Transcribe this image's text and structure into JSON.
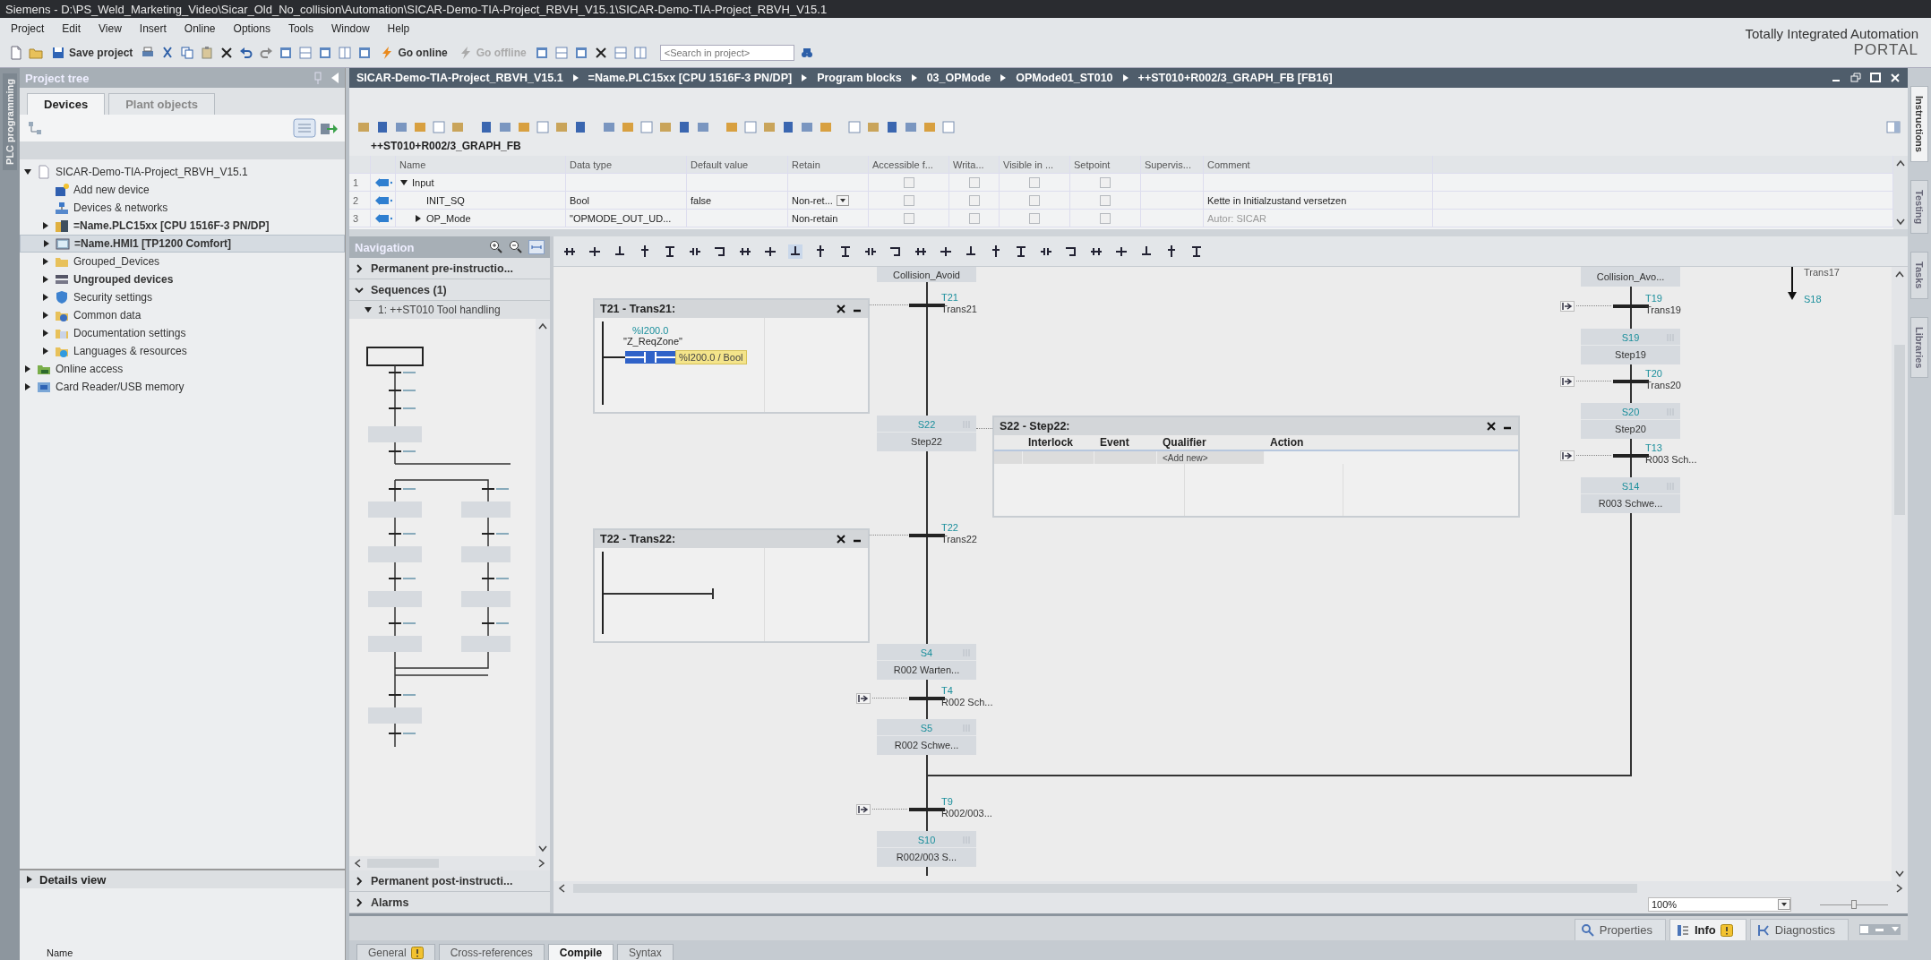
{
  "window": {
    "title": "Siemens  -  D:\\PS_Weld_Marketing_Video\\Sicar_Old_No_collision\\Automation\\SICAR-Demo-TIA-Project_RBVH_V15.1\\SICAR-Demo-TIA-Project_RBVH_V15.1"
  },
  "menu": [
    "Project",
    "Edit",
    "View",
    "Insert",
    "Online",
    "Options",
    "Tools",
    "Window",
    "Help"
  ],
  "toolbar": {
    "save": {
      "label": "Save project"
    },
    "go_online": {
      "label": "Go online",
      "disabled": false
    },
    "go_offline": {
      "label": "Go offline",
      "disabled": true
    },
    "search": {
      "placeholder": "<Search in project>"
    }
  },
  "branding": {
    "line1": "Totally Integrated Automation",
    "line2": "PORTAL"
  },
  "side_strip": {
    "label": "PLC programming"
  },
  "project_tree": {
    "title": "Project tree",
    "tabs": [
      {
        "label": "Devices",
        "selected": true
      },
      {
        "label": "Plant objects",
        "selected": false
      }
    ],
    "items": [
      {
        "label": "SICAR-Demo-TIA-Project_RBVH_V15.1",
        "kind": "project",
        "expanded": true,
        "selected": false,
        "bold": false,
        "children": [
          {
            "label": "Add new device",
            "kind": "add-device",
            "selected": false,
            "bold": false
          },
          {
            "label": "Devices & networks",
            "kind": "network",
            "selected": false,
            "bold": false
          },
          {
            "label": "=Name.PLC15xx [CPU 1516F-3 PN/DP]",
            "kind": "plc",
            "expanded": false,
            "selected": false,
            "bold": true
          },
          {
            "label": "=Name.HMI1 [TP1200 Comfort]",
            "kind": "hmi",
            "expanded": false,
            "selected": true,
            "bold": true
          },
          {
            "label": "Grouped_Devices",
            "kind": "group",
            "expanded": false,
            "selected": false,
            "bold": false
          },
          {
            "label": "Ungrouped devices",
            "kind": "ungrouped",
            "expanded": false,
            "selected": false,
            "bold": true
          },
          {
            "label": "Security settings",
            "kind": "security",
            "expanded": false,
            "selected": false,
            "bold": false
          },
          {
            "label": "Common data",
            "kind": "common",
            "expanded": false,
            "selected": false,
            "bold": false
          },
          {
            "label": "Documentation settings",
            "kind": "documentation",
            "expanded": false,
            "selected": false,
            "bold": false
          },
          {
            "label": "Languages & resources",
            "kind": "languages",
            "expanded": false,
            "selected": false,
            "bold": false
          }
        ]
      },
      {
        "label": "Online access",
        "kind": "online",
        "expanded": false,
        "selected": false,
        "bold": false
      },
      {
        "label": "Card Reader/USB memory",
        "kind": "card-reader",
        "expanded": false,
        "selected": false,
        "bold": false
      }
    ]
  },
  "details_view": {
    "title": "Details view",
    "column": "Name"
  },
  "editor": {
    "breadcrumb": [
      "SICAR-Demo-TIA-Project_RBVH_V15.1",
      "=Name.PLC15xx [CPU 1516F-3 PN/DP]",
      "Program blocks",
      "03_OPMode",
      "OPMode01_ST010",
      "++ST010+R002/3_GRAPH_FB [FB16]"
    ],
    "block_title": "++ST010+R002/3_GRAPH_FB",
    "interface": {
      "columns": [
        "Name",
        "Data type",
        "Default value",
        "Retain",
        "Accessible f...",
        "Writa...",
        "Visible in ...",
        "Setpoint",
        "Supervis...",
        "Comment"
      ],
      "rows": [
        {
          "number": "1",
          "kind": "section",
          "name": "Input",
          "expanded": true,
          "flags": [
            false,
            false,
            false,
            false
          ]
        },
        {
          "number": "2",
          "kind": "variable",
          "name": "INIT_SQ",
          "data_type": "Bool",
          "default_value": "false",
          "retain": "Non-ret...",
          "retain_dropdown": true,
          "flags": [
            false,
            false,
            false,
            false
          ],
          "comment": "Kette in Initialzustand versetzen",
          "comment_dim": false
        },
        {
          "number": "3",
          "kind": "struct",
          "name": "OP_Mode",
          "expanded": false,
          "data_type": "\"OPMODE_OUT_UD...",
          "retain": "Non-retain",
          "retain_dropdown": false,
          "flags": [
            false,
            false,
            false,
            false
          ],
          "comment": "Autor: SICAR",
          "comment_dim": true
        }
      ]
    }
  },
  "navigation": {
    "title": "Navigation",
    "sections": [
      {
        "label": "Permanent pre-instructio...",
        "expanded": false
      },
      {
        "label": "Sequences (1)",
        "expanded": true,
        "sequence": "1: ++ST010 Tool handling"
      },
      {
        "label": "Permanent post-instructi...",
        "expanded": false
      },
      {
        "label": "Alarms",
        "expanded": false
      }
    ]
  },
  "graph": {
    "steps": [
      {
        "kind": "cut",
        "name": "Collision_Avoid"
      },
      {
        "kind": "step",
        "number": "S22",
        "name": "Step22"
      },
      {
        "kind": "step",
        "number": "S4",
        "name": "R002 Warten..."
      },
      {
        "kind": "step",
        "number": "S5",
        "name": "R002 Schwe..."
      },
      {
        "kind": "step",
        "number": "S10",
        "name": "R002/003 S..."
      },
      {
        "kind": "cut",
        "name": "Collision_Avo..."
      },
      {
        "kind": "step",
        "number": "S19",
        "name": "Step19"
      },
      {
        "kind": "step",
        "number": "S20",
        "name": "Step20"
      },
      {
        "kind": "step",
        "number": "S14",
        "name": "R003 Schwe..."
      }
    ],
    "transitions": [
      {
        "number": "T21",
        "name": "Trans21",
        "jump": false
      },
      {
        "number": "T22",
        "name": "Trans22",
        "jump": false
      },
      {
        "number": "T4",
        "name": "R002 Sch...",
        "jump": true
      },
      {
        "number": "T9",
        "name": "R002/003...",
        "jump": true
      },
      {
        "number": "T19",
        "name": "Trans19",
        "jump": true
      },
      {
        "number": "T20",
        "name": "Trans20",
        "jump": true
      },
      {
        "number": "T13",
        "name": "R003 Sch...",
        "jump": true
      }
    ],
    "jump_arrow": {
      "name": "Trans17",
      "target": "S18"
    },
    "popups": [
      {
        "kind": "transition",
        "title": "T21 - Trans21:",
        "operand": {
          "address": "%I200.0",
          "tag": "\"Z_ReqZone\"",
          "selected": true,
          "tooltip": "%I200.0 / Bool"
        }
      },
      {
        "kind": "step",
        "title": "S22 - Step22:",
        "columns": [
          "Interlock",
          "Event",
          "Qualifier",
          "Action"
        ],
        "add_new": "<Add new>"
      },
      {
        "kind": "transition",
        "title": "T22 - Trans22:"
      }
    ]
  },
  "zoom": {
    "value": "100%",
    "level": 0.5
  },
  "inspector_tabs": [
    {
      "label": "Properties",
      "selected": false,
      "warning": false
    },
    {
      "label": "Info",
      "selected": true,
      "warning": true
    },
    {
      "label": "Diagnostics",
      "selected": false,
      "warning": false
    }
  ],
  "bottom_tabs": [
    {
      "label": "General",
      "selected": false,
      "warning": true
    },
    {
      "label": "Cross-references",
      "selected": false,
      "warning": false
    },
    {
      "label": "Compile",
      "selected": true,
      "warning": false
    },
    {
      "label": "Syntax",
      "selected": false,
      "warning": false
    }
  ],
  "right_strip": [
    {
      "label": "Instructions",
      "selected": true
    },
    {
      "label": "Testing",
      "selected": false
    },
    {
      "label": "Tasks",
      "selected": false
    },
    {
      "label": "Libraries",
      "selected": false
    }
  ]
}
